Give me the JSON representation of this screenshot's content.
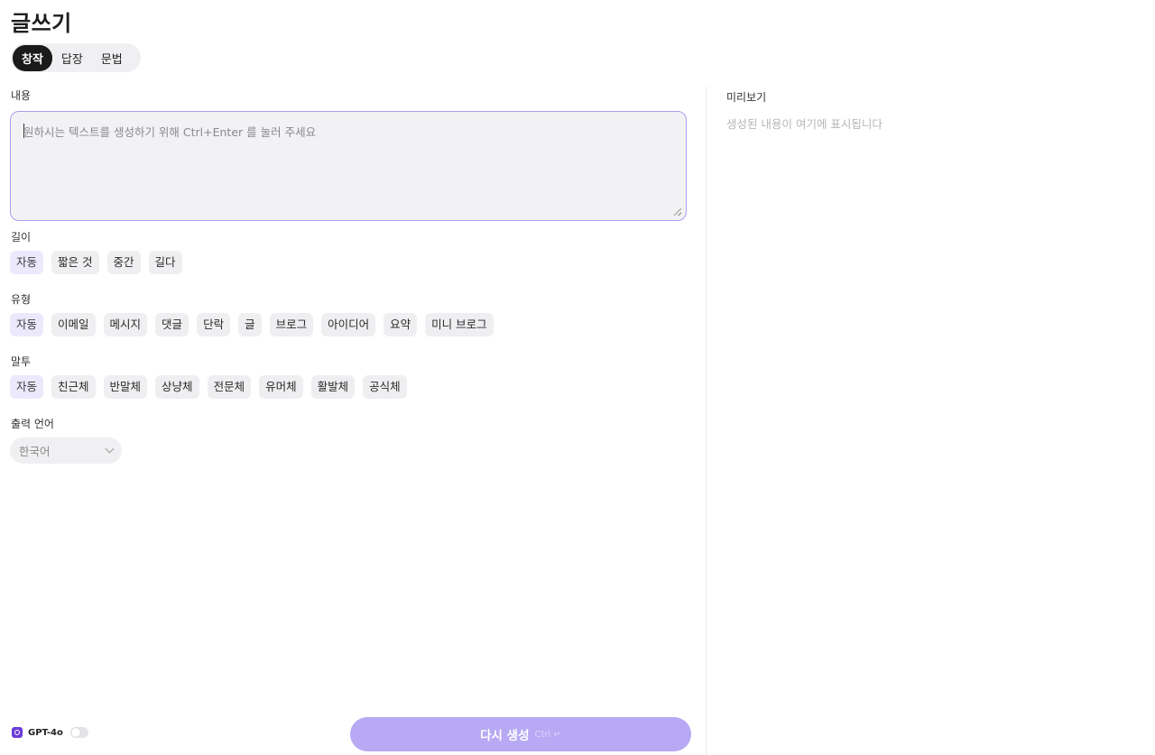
{
  "page": {
    "title": "글쓰기"
  },
  "mode_tabs": [
    {
      "label": "창작",
      "active": true
    },
    {
      "label": "답장",
      "active": false
    },
    {
      "label": "문법",
      "active": false
    }
  ],
  "content": {
    "label": "내용",
    "placeholder": "원하시는 텍스트를 생성하기 위해 Ctrl+Enter 를 눌러 주세요",
    "value": ""
  },
  "length": {
    "label": "길이",
    "options": [
      "자동",
      "짧은 것",
      "중간",
      "길다"
    ],
    "selected": "자동"
  },
  "type": {
    "label": "유형",
    "options": [
      "자동",
      "이메일",
      "메시지",
      "댓글",
      "단락",
      "글",
      "브로그",
      "아이디어",
      "요약",
      "미니 브로그"
    ],
    "selected": "자동"
  },
  "tone": {
    "label": "말투",
    "options": [
      "자동",
      "친근체",
      "반말체",
      "상냥체",
      "전문체",
      "유머체",
      "활발체",
      "공식체"
    ],
    "selected": "자동"
  },
  "output_language": {
    "label": "출력 언어",
    "selected": "한국어"
  },
  "preview": {
    "title": "미리보기",
    "placeholder": "생성된 내용이 여기에 표시됩니다"
  },
  "model": {
    "name": "GPT-4o",
    "toggle_on": false,
    "icon": "model-icon"
  },
  "regenerate": {
    "label": "다시 생성",
    "shortcut": "Ctrl ↵"
  },
  "colors": {
    "accent": "#b7a9f3",
    "focus_border": "#a89ff2",
    "active_chip": "#ece9fd"
  }
}
